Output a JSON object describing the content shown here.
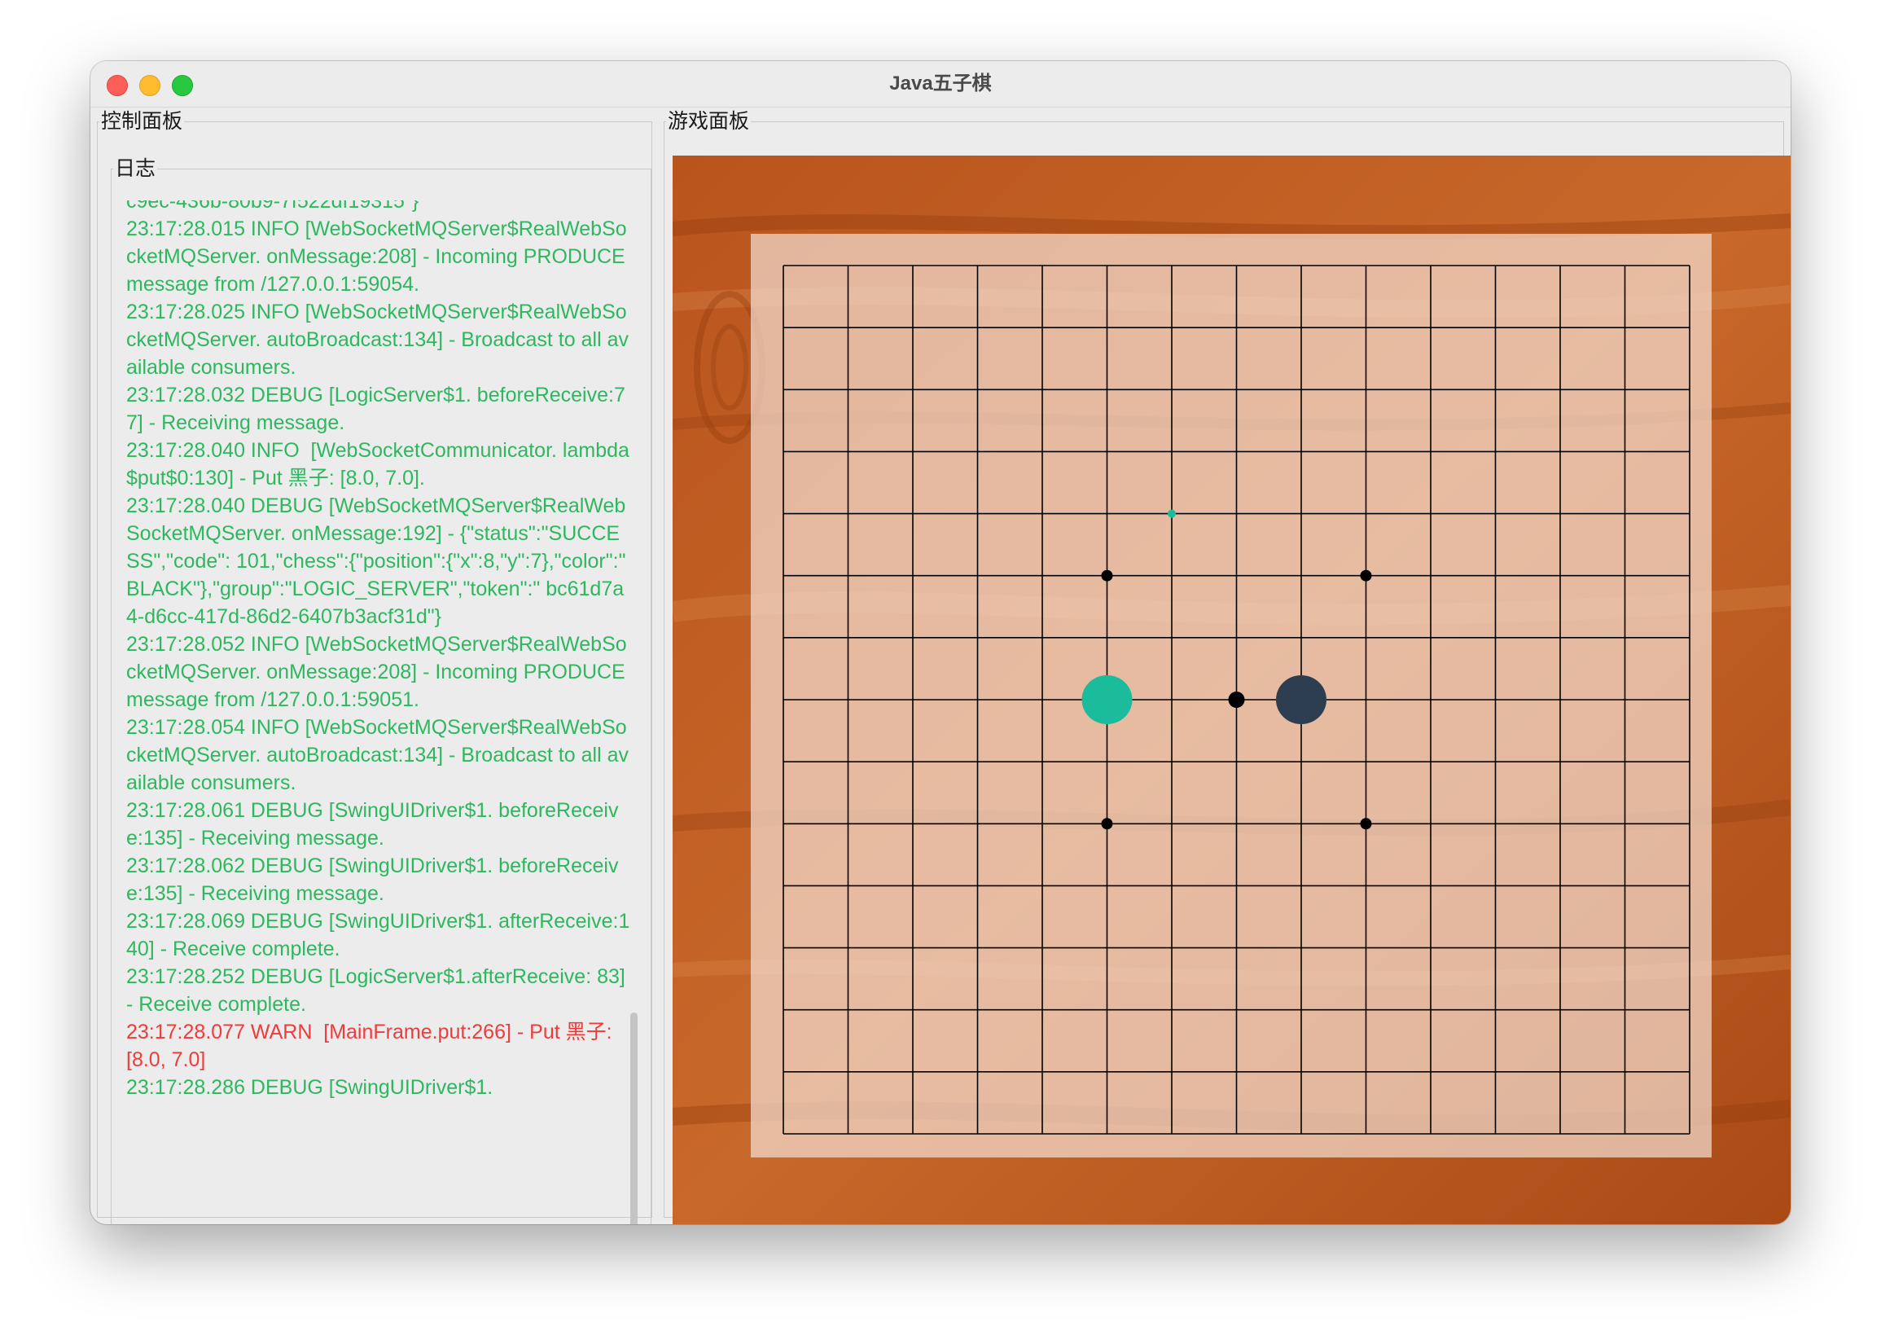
{
  "window": {
    "title": "Java五子棋"
  },
  "control_panel": {
    "title": "控制面板",
    "log": {
      "title": "日志",
      "lines": [
        {
          "text": "c9ec-436b-80b9-7f522df19315\"}",
          "level": "info"
        },
        {
          "text": "23:17:28.015 INFO [WebSocketMQServer$RealWebSocketMQServer. onMessage:208] - Incoming PRODUCE message from /127.0.0.1:59054.",
          "level": "info"
        },
        {
          "text": "23:17:28.025 INFO [WebSocketMQServer$RealWebSocketMQServer. autoBroadcast:134] - Broadcast to all available consumers.",
          "level": "info"
        },
        {
          "text": "23:17:28.032 DEBUG [LogicServer$1. beforeReceive:77] - Receiving message.",
          "level": "debug"
        },
        {
          "text": "23:17:28.040 INFO  [WebSocketCommunicator. lambda$put$0:130] - Put 黑子: [8.0, 7.0].",
          "level": "info"
        },
        {
          "text": "23:17:28.040 DEBUG [WebSocketMQServer$RealWebSocketMQServer. onMessage:192] - {\"status\":\"SUCCESS\",\"code\": 101,\"chess\":{\"position\":{\"x\":8,\"y\":7},\"color\":\" BLACK\"},\"group\":\"LOGIC_SERVER\",\"token\":\" bc61d7a4-d6cc-417d-86d2-6407b3acf31d\"}",
          "level": "debug"
        },
        {
          "text": "23:17:28.052 INFO [WebSocketMQServer$RealWebSocketMQServer. onMessage:208] - Incoming PRODUCE message from /127.0.0.1:59051.",
          "level": "info"
        },
        {
          "text": "23:17:28.054 INFO [WebSocketMQServer$RealWebSocketMQServer. autoBroadcast:134] - Broadcast to all available consumers.",
          "level": "info"
        },
        {
          "text": "23:17:28.061 DEBUG [SwingUIDriver$1. beforeReceive:135] - Receiving message.",
          "level": "debug"
        },
        {
          "text": "23:17:28.062 DEBUG [SwingUIDriver$1. beforeReceive:135] - Receiving message.",
          "level": "debug"
        },
        {
          "text": "23:17:28.069 DEBUG [SwingUIDriver$1. afterReceive:140] - Receive complete.",
          "level": "debug"
        },
        {
          "text": "23:17:28.252 DEBUG [LogicServer$1.afterReceive: 83] - Receive complete.",
          "level": "debug"
        },
        {
          "text": "23:17:28.077 WARN  [MainFrame.put:266] - Put 黑子: [8.0, 7.0]",
          "level": "warn"
        },
        {
          "text": "23:17:28.286 DEBUG [SwingUIDriver$1.",
          "level": "debug"
        }
      ]
    }
  },
  "game_panel": {
    "title": "游戏面板",
    "board": {
      "size": 15,
      "star_points": [
        [
          5,
          5
        ],
        [
          9,
          5
        ],
        [
          5,
          9
        ],
        [
          9,
          9
        ]
      ],
      "stones": [
        {
          "col": 5,
          "row": 7,
          "color": "green"
        },
        {
          "col": 8,
          "row": 7,
          "color": "dark"
        }
      ],
      "last_move_marker": {
        "col": 6,
        "row": 4
      },
      "placed_marker": {
        "col": 7,
        "row": 7
      }
    }
  },
  "colors": {
    "log_info": "#2fb760",
    "log_warn": "#ee3b3b",
    "stone_green": "#1abc9c",
    "stone_dark": "#2c3e50",
    "grid": "#000000"
  }
}
